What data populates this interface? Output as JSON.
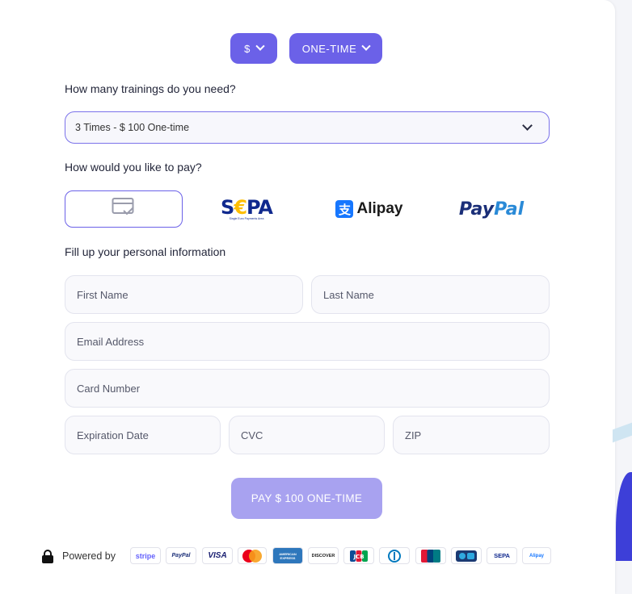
{
  "header": {
    "currency_label": "$",
    "frequency_label": "ONE-TIME"
  },
  "trainings": {
    "question": "How many trainings do you need?",
    "selected": "3 Times - $ 100 One-time"
  },
  "payment": {
    "question": "How would you like to pay?",
    "options": {
      "sepa": "SEPA",
      "sepa_sub": "Single Euro Payments Area",
      "alipay": "Alipay",
      "paypal_a": "Pay",
      "paypal_b": "Pal"
    }
  },
  "personal": {
    "heading": "Fill up your personal information",
    "first_name": "First Name",
    "last_name": "Last Name",
    "email": "Email Address",
    "card_number": "Card Number",
    "expiration": "Expiration Date",
    "cvc": "CVC",
    "zip": "ZIP"
  },
  "submit_label": "PAY $ 100 ONE-TIME",
  "footer": {
    "powered_by": "Powered by",
    "brands": {
      "stripe": "stripe",
      "paypal": "PayPal",
      "visa": "VISA",
      "amex": "AMERICAN EXPRESS",
      "discover": "DISCOVER",
      "jcb": "JCB",
      "sepa": "SEPA",
      "alipay": "Alipay"
    }
  },
  "colors": {
    "accent": "#6b61e8",
    "button_disabled": "#a8a2f0",
    "select_border": "#7b72ea"
  }
}
